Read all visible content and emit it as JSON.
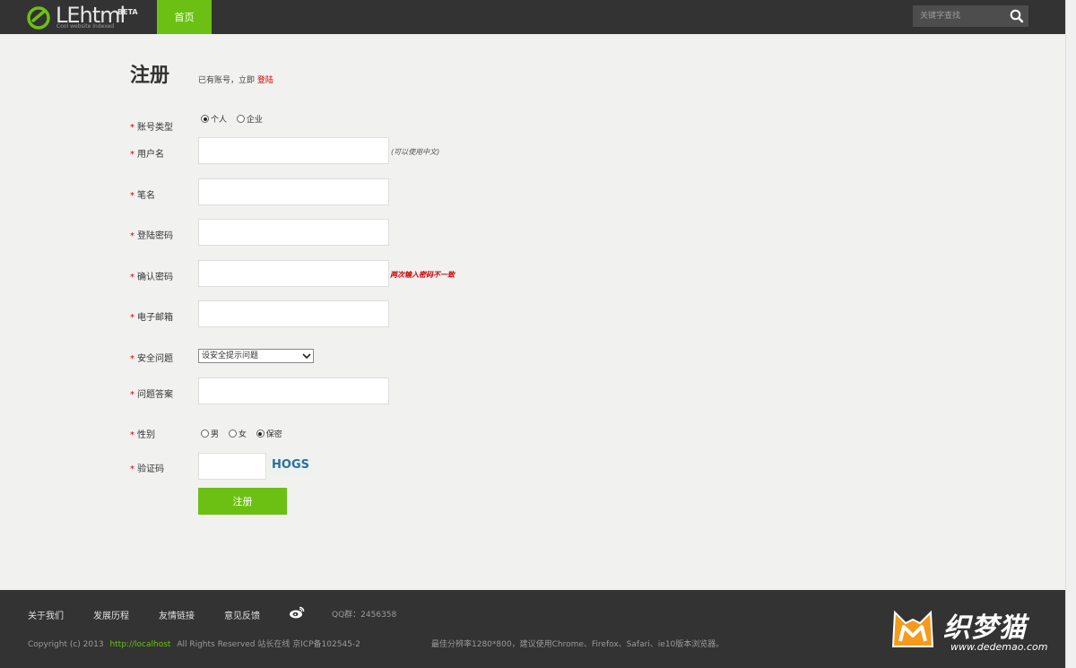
{
  "header": {
    "logo_text": "LEhtml",
    "logo_beta": "BETA",
    "logo_sub": "Cool website Indexed",
    "nav_home": "首页",
    "search_placeholder": "关键字查找",
    "accent_color": "#6cc013"
  },
  "page": {
    "title": "注册",
    "login_hint": "已有账号，立即",
    "login_link": "登陆"
  },
  "form": {
    "account_type": {
      "label": "账号类型",
      "options": [
        "个人",
        "企业"
      ],
      "selected": "个人"
    },
    "username": {
      "label": "用户名",
      "value": "",
      "hint": "(可以使用中文)"
    },
    "penname": {
      "label": "笔名",
      "value": ""
    },
    "password": {
      "label": "登陆密码",
      "value": ""
    },
    "confirm_password": {
      "label": "确认密码",
      "value": "",
      "error": "两次输入密码不一致"
    },
    "email": {
      "label": "电子邮箱",
      "value": ""
    },
    "security_question": {
      "label": "安全问题",
      "selected": "设安全提示问题"
    },
    "answer": {
      "label": "问题答案",
      "value": ""
    },
    "gender": {
      "label": "性别",
      "options": [
        "男",
        "女",
        "保密"
      ],
      "selected": "保密"
    },
    "captcha": {
      "label": "验证码",
      "value": "",
      "image_text": "HOGS"
    },
    "required_mark": "*",
    "submit_label": "注册"
  },
  "footer": {
    "nav": [
      "关于我们",
      "发展历程",
      "友情链接",
      "意见反馈"
    ],
    "weibo_icon": "weibo-icon",
    "qq_group": "QQ群：2456358",
    "copyright_prefix": "Copyright (c) 2013",
    "copyright_link": "http://localhost",
    "copyright_suffix": "All Rights Reserved  站长在线  京ICP备102545-2",
    "best_view": "最佳分辨率1280*800，建议使用Chrome、Firefox、Safari、ie10版本浏览器。",
    "watermark_name": "织梦猫",
    "watermark_url": "www.dedemao.com"
  }
}
